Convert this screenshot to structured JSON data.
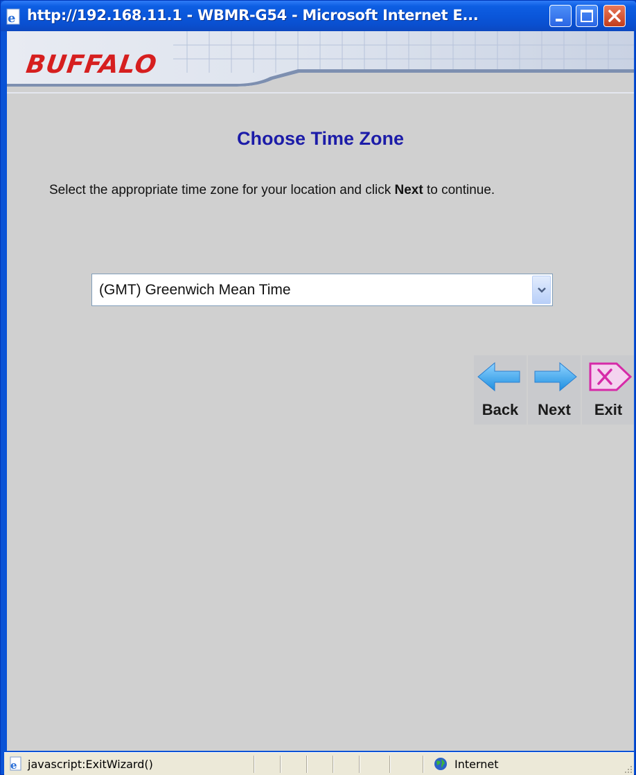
{
  "window": {
    "title": "http://192.168.11.1 - WBMR-G54 - Microsoft Internet E...",
    "accent": "#0a55d8"
  },
  "banner": {
    "logo_text": "BUFFALO",
    "logo_color": "#d61f1f"
  },
  "wizard": {
    "heading": "Choose Time Zone",
    "instruction_before": "Select the appropriate time zone for your location and click ",
    "instruction_bold": "Next",
    "instruction_after": " to continue.",
    "heading_color": "#1c1ca8",
    "timezone": {
      "selected": "(GMT) Greenwich Mean Time"
    },
    "buttons": {
      "back_label": "Back",
      "next_label": "Next",
      "exit_label": "Exit"
    }
  },
  "statusbar": {
    "text": "javascript:ExitWizard()",
    "zone": "Internet"
  },
  "icons": {
    "title": "ie-page-icon",
    "back": "blue-left-arrow-icon",
    "next": "blue-right-arrow-icon",
    "exit": "pink-exit-icon",
    "status": "ie-page-icon",
    "zone": "globe-icon"
  }
}
